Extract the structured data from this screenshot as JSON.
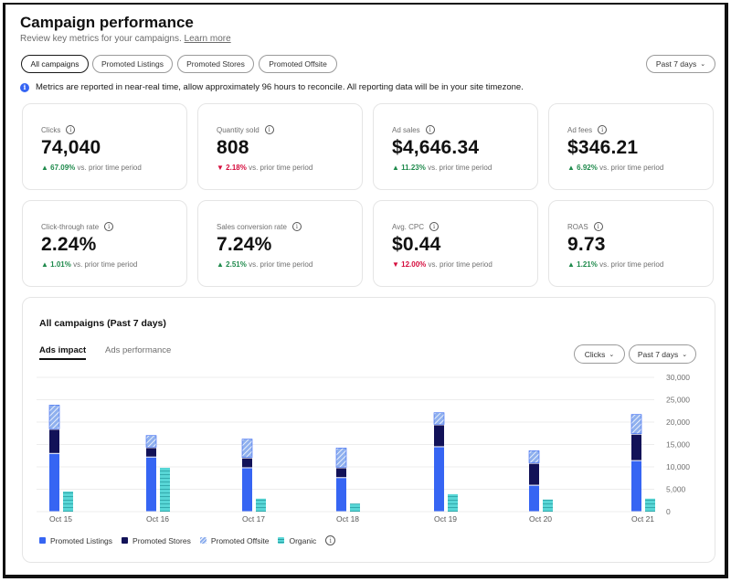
{
  "header": {
    "title": "Campaign performance",
    "subtitle": "Review key metrics for your campaigns.",
    "learn_more": "Learn more"
  },
  "filters": {
    "tabs": [
      {
        "label": "All campaigns",
        "active": true
      },
      {
        "label": "Promoted Listings",
        "active": false
      },
      {
        "label": "Promoted Stores",
        "active": false
      },
      {
        "label": "Promoted Offsite",
        "active": false
      }
    ],
    "date_range": "Past 7 days"
  },
  "info": {
    "icon": "info-icon",
    "text": "Metrics are reported in near-real time, allow approximately 96 hours to reconcile. All reporting data will be in your site timezone."
  },
  "metrics": [
    {
      "label": "Clicks",
      "value": "74,040",
      "change": "67.09%",
      "direction": "up",
      "suffix": "vs. prior time period"
    },
    {
      "label": "Quantity sold",
      "value": "808",
      "change": "2.18%",
      "direction": "down",
      "suffix": "vs. prior time period"
    },
    {
      "label": "Ad sales",
      "value": "$4,646.34",
      "change": "11.23%",
      "direction": "up",
      "suffix": "vs. prior time period"
    },
    {
      "label": "Ad fees",
      "value": "$346.21",
      "change": "6.92%",
      "direction": "up",
      "suffix": "vs. prior time period"
    },
    {
      "label": "Click-through rate",
      "value": "2.24%",
      "change": "1.01%",
      "direction": "up",
      "suffix": "vs. prior time period"
    },
    {
      "label": "Sales conversion rate",
      "value": "7.24%",
      "change": "2.51%",
      "direction": "up",
      "suffix": "vs. prior time period"
    },
    {
      "label": "Avg. CPC",
      "value": "$0.44",
      "change": "12.00%",
      "direction": "down",
      "suffix": "vs. prior time period"
    },
    {
      "label": "ROAS",
      "value": "9.73",
      "change": "1.21%",
      "direction": "up",
      "suffix": "vs. prior time period"
    }
  ],
  "panel": {
    "title": "All campaigns (Past 7 days)",
    "tabs": [
      {
        "label": "Ads impact",
        "active": true
      },
      {
        "label": "Ads performance",
        "active": false
      }
    ],
    "metric_dropdown": "Clicks",
    "range_dropdown": "Past 7 days"
  },
  "colors": {
    "promoted_listings": "#3665f3",
    "promoted_stores": "#121258",
    "promoted_offsite": "#8fb0ee",
    "organic": "#58d6d6",
    "up": "#1f8a4c",
    "down": "#d50b3c",
    "info": "#3665f3"
  },
  "chart_data": {
    "type": "bar",
    "stacked": true,
    "title": "All campaigns (Past 7 days)",
    "xlabel": "",
    "ylabel": "Clicks",
    "categories": [
      "Oct 15",
      "Oct 16",
      "Oct 17",
      "Oct 18",
      "Oct 19",
      "Oct 20",
      "Oct 21"
    ],
    "ylim": [
      0,
      30000
    ],
    "yticks": [
      "0",
      "5,000",
      "10,000",
      "15,000",
      "20,000",
      "25,000",
      "30,000"
    ],
    "ytick_values": [
      0,
      5000,
      10000,
      15000,
      20000,
      25000,
      30000
    ],
    "grid": true,
    "series": [
      {
        "name": "Promoted Listings",
        "stack": "ads",
        "values": [
          13000,
          12200,
          9800,
          7600,
          14500,
          5900,
          11400
        ]
      },
      {
        "name": "Promoted Stores",
        "stack": "ads",
        "values": [
          5400,
          2100,
          2200,
          2200,
          4900,
          4900,
          5900
        ]
      },
      {
        "name": "Promoted Offsite",
        "stack": "ads",
        "values": [
          5500,
          2800,
          4300,
          4500,
          2800,
          2900,
          4500
        ]
      },
      {
        "name": "Organic",
        "stack": "organic",
        "values": [
          4500,
          9800,
          2900,
          1800,
          3900,
          2700,
          2900
        ]
      }
    ],
    "legend": [
      "Promoted Listings",
      "Promoted Stores",
      "Promoted Offsite",
      "Organic"
    ],
    "legend_position": "bottom-left"
  }
}
